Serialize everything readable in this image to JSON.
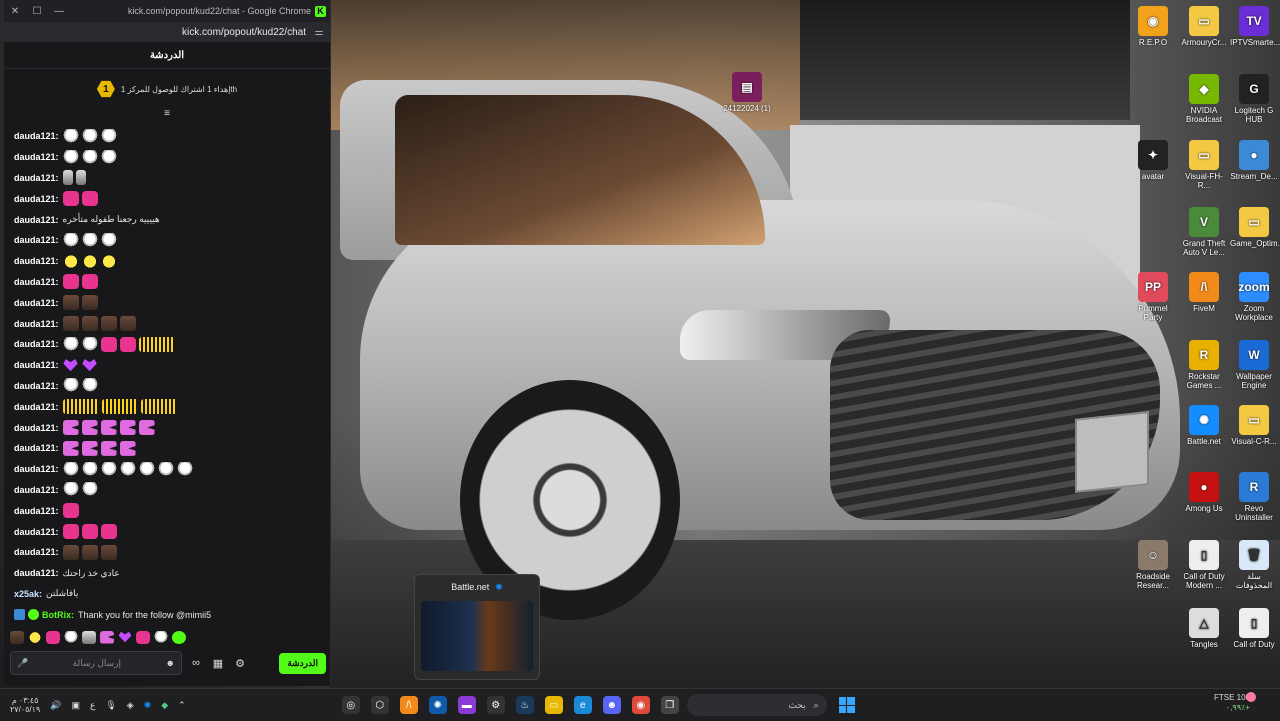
{
  "window": {
    "title": "kick.com/popout/kud22/chat - Google Chrome",
    "url": "kick.com/popout/kud22/chat",
    "minimize": "—",
    "maximize": "☐",
    "close": "✕",
    "logo": "K"
  },
  "chat": {
    "header": "الدردشة",
    "sub_goal_count": "1",
    "sub_goal_text": "إهداء 1 اشتراك للوصول للمركز 1th",
    "collapse_icon": "≡",
    "messages": [
      {
        "user": "dauda121:",
        "text": "",
        "emotes": [
          "ghost",
          "ghost",
          "ghost"
        ]
      },
      {
        "user": "dauda121:",
        "text": "",
        "emotes": [
          "ghost",
          "ghost",
          "ghost"
        ]
      },
      {
        "user": "dauda121:",
        "text": "",
        "emotes": [
          "pin",
          "pin"
        ]
      },
      {
        "user": "dauda121:",
        "text": "",
        "emotes": [
          "pink",
          "pink"
        ]
      },
      {
        "user": "dauda121:",
        "text": "هييييه رجعنا طفوله متأخره",
        "emotes": []
      },
      {
        "user": "dauda121:",
        "text": "",
        "emotes": [
          "ghost",
          "ghost",
          "ghost"
        ]
      },
      {
        "user": "dauda121:",
        "text": "",
        "emotes": [
          "duck",
          "duck",
          "duck"
        ]
      },
      {
        "user": "dauda121:",
        "text": "",
        "emotes": [
          "pink",
          "pink"
        ]
      },
      {
        "user": "dauda121:",
        "text": "",
        "emotes": [
          "face",
          "face"
        ]
      },
      {
        "user": "dauda121:",
        "text": "",
        "emotes": [
          "face",
          "face",
          "face",
          "face"
        ]
      },
      {
        "user": "dauda121:",
        "text": "",
        "emotes": [
          "ghost",
          "ghost",
          "pink",
          "pink",
          "bars"
        ]
      },
      {
        "user": "dauda121:",
        "text": "",
        "emotes": [
          "heart",
          "heart"
        ]
      },
      {
        "user": "dauda121:",
        "text": "",
        "emotes": [
          "ghost",
          "ghost"
        ]
      },
      {
        "user": "dauda121:",
        "text": "",
        "emotes": [
          "bars",
          "bars",
          "bars"
        ]
      },
      {
        "user": "dauda121:",
        "text": "",
        "emotes": [
          "pac",
          "pac",
          "pac",
          "pac",
          "pac"
        ]
      },
      {
        "user": "dauda121:",
        "text": "",
        "emotes": [
          "pac",
          "pac",
          "pac",
          "pac"
        ]
      },
      {
        "user": "dauda121:",
        "text": "",
        "emotes": [
          "ghost",
          "ghost",
          "ghost",
          "ghost",
          "ghost",
          "ghost",
          "ghost"
        ]
      },
      {
        "user": "dauda121:",
        "text": "",
        "emotes": [
          "ghost",
          "ghost"
        ]
      },
      {
        "user": "dauda121:",
        "text": "",
        "emotes": [
          "pink"
        ]
      },
      {
        "user": "dauda121:",
        "text": "",
        "emotes": [
          "pink",
          "pink",
          "pink"
        ]
      },
      {
        "user": "dauda121:",
        "text": "",
        "emotes": [
          "face",
          "face",
          "face"
        ]
      },
      {
        "user": "dauda121:",
        "text": "عادي خذ راحتك",
        "emotes": []
      },
      {
        "user": "x25ak:",
        "text": "يافاشلتن",
        "emotes": [],
        "alt": true
      },
      {
        "user": "BotRix:",
        "text": "Thank you for the follow @mimii5",
        "emotes": [],
        "bot": true
      }
    ],
    "input_placeholder": "إرسال رسالة",
    "send_label": "الدردشة",
    "emoji_icon": "☻",
    "settings_icon": "⚙",
    "store_icon": "▦",
    "mic_icon": "🎤",
    "link_icon": "∞"
  },
  "desktop_icons": [
    {
      "label": "R.E.P.O",
      "color": "#f2a21a",
      "glyph": "◉"
    },
    {
      "label": "ArmouryCr...",
      "color": "#f3c843",
      "glyph": "▭"
    },
    {
      "label": "IPTVSmarte...",
      "color": "#6a2dd6",
      "glyph": "TV"
    },
    {
      "label": "NVIDIA Broadcast",
      "color": "#76b900",
      "glyph": "◆"
    },
    {
      "label": "Logitech G HUB",
      "color": "#222",
      "glyph": "G"
    },
    {
      "label": "24122024 (1)",
      "color": "#7a1f5c",
      "glyph": "▤"
    },
    {
      "label": "avatar",
      "color": "#222",
      "glyph": "✦"
    },
    {
      "label": "Visual-FH-R...",
      "color": "#f3c843",
      "glyph": "▭"
    },
    {
      "label": "Stream_De...",
      "color": "#3a8ad6",
      "glyph": "●"
    },
    {
      "label": "Grand Theft Auto V Le...",
      "color": "#4a8a3a",
      "glyph": "V"
    },
    {
      "label": "Game_Optim...",
      "color": "#f3c843",
      "glyph": "▭"
    },
    {
      "label": "Pummel Party",
      "color": "#e04a5a",
      "glyph": "PP"
    },
    {
      "label": "FiveM",
      "color": "#f28a1a",
      "glyph": "/\\"
    },
    {
      "label": "Zoom Workplace",
      "color": "#2d8cff",
      "glyph": "zoom"
    },
    {
      "label": "Rockstar Games ...",
      "color": "#e8b000",
      "glyph": "R"
    },
    {
      "label": "Wallpaper Engine",
      "color": "#1a6ad6",
      "glyph": "W"
    },
    {
      "label": "Battle.net",
      "color": "#148eff",
      "glyph": "✺"
    },
    {
      "label": "Visual-C-R...",
      "color": "#f3c843",
      "glyph": "▭"
    },
    {
      "label": "Among Us",
      "color": "#c51111",
      "glyph": "●"
    },
    {
      "label": "Revo Uninstaller",
      "color": "#2a7ad6",
      "glyph": "R"
    },
    {
      "label": "Roadside Resear...",
      "color": "#8a7a6a",
      "glyph": "☺"
    },
    {
      "label": "Call of Duty Modern ...",
      "color": "#eeeeee",
      "glyph": "▯"
    },
    {
      "label": "سلة المحذوفات",
      "color": "#d8e8f8",
      "glyph": "🗑"
    },
    {
      "label": "Tangles",
      "color": "#dddddd",
      "glyph": "△"
    },
    {
      "label": "Call of Duty",
      "color": "#eeeeee",
      "glyph": "▯"
    }
  ],
  "preview": {
    "title": "Battle.net"
  },
  "taskbar": {
    "clock_time": "٠٣:٤٥ م",
    "clock_date": "٢٧/٠٥/١٩",
    "lang": "ع",
    "search_placeholder": "بحث",
    "stock_name": "FTSE 100",
    "stock_change": "٠,٩٩٪+",
    "notif_count": "1"
  }
}
